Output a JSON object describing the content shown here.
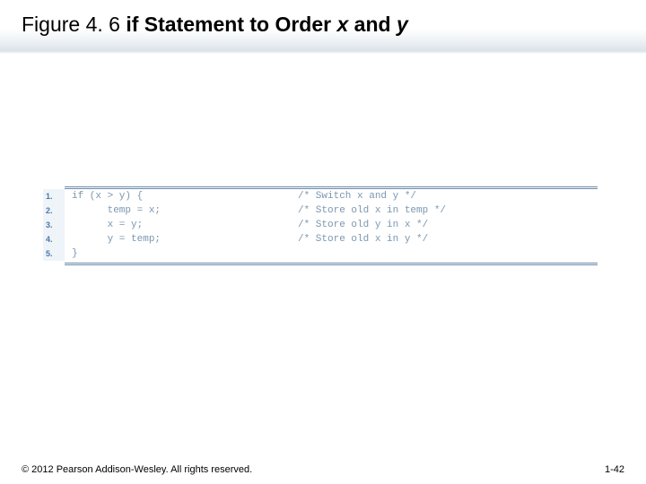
{
  "title": {
    "prefix": "Figure 4. 6  ",
    "bold1": "if Statement to Order ",
    "var1": "x",
    "and": " and ",
    "var2": "y"
  },
  "code": {
    "lines": [
      {
        "n": "1.",
        "src": "if (x > y) {",
        "cmt": "/* Switch x and y */"
      },
      {
        "n": "2.",
        "src": "      temp = x;",
        "cmt": "/* Store old x in temp */"
      },
      {
        "n": "3.",
        "src": "      x = y;",
        "cmt": "/* Store old y in x */"
      },
      {
        "n": "4.",
        "src": "      y = temp;",
        "cmt": "/* Store old x in y */"
      },
      {
        "n": "5.",
        "src": "}",
        "cmt": ""
      }
    ]
  },
  "footer": {
    "copyright": "© 2012 Pearson Addison-Wesley. All rights reserved.",
    "page": "1-42"
  }
}
